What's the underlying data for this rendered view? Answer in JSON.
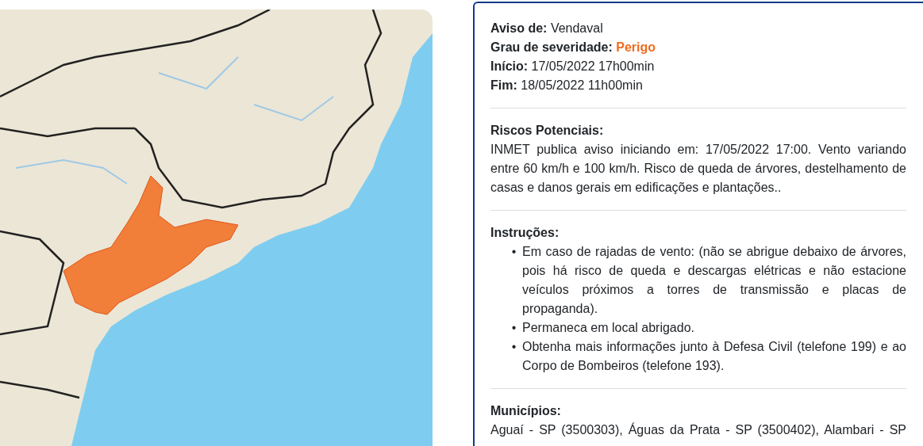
{
  "header_fields": [
    {
      "label": "Aviso de:",
      "value": "Vendaval",
      "kind": "plain"
    },
    {
      "label": "Grau de severidade:",
      "value": "Perigo",
      "kind": "severity"
    },
    {
      "label": "Início:",
      "value": "17/05/2022 17h00min",
      "kind": "plain"
    },
    {
      "label": "Fim:",
      "value": "18/05/2022 11h00min",
      "kind": "plain"
    }
  ],
  "sections": [
    {
      "title": "Riscos Potenciais:",
      "kind": "paragraph",
      "cut": false,
      "text": "INMET publica aviso iniciando em: 17/05/2022 17:00. Vento variando entre 60 km/h e 100 km/h. Risco de queda de árvores, destelhamento de casas e danos gerais em edificações e plantações.."
    },
    {
      "title": "Instruções:",
      "kind": "list",
      "items": [
        {
          "marker": "•",
          "text": "Em caso de rajadas de vento: (não se abrigue debaixo de árvores, pois há risco de queda e descargas elétricas e não estacione veículos próximos a torres de transmissão e placas de propaganda)."
        },
        {
          "marker": "•",
          "text": "Permaneca em local abrigado."
        },
        {
          "marker": "•",
          "text": "Obtenha mais informações junto à Defesa Civil (telefone 199) e ao Corpo de Bombeiros (telefone 193)."
        }
      ]
    },
    {
      "title": "Municípios:",
      "kind": "paragraph",
      "cut": true,
      "text": "Aguaí - SP (3500303), Águas da Prata - SP (3500402), Alambari - SP"
    }
  ]
}
